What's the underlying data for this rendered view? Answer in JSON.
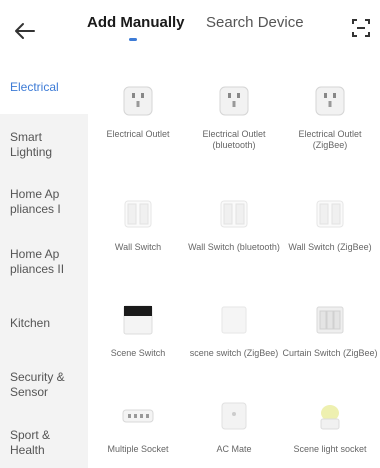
{
  "header": {
    "tabs": [
      {
        "label": "Add Manually",
        "active": true
      },
      {
        "label": "Search Device",
        "active": false
      }
    ],
    "icons": [
      "back-arrow-icon",
      "scan-icon"
    ]
  },
  "sidebar": {
    "items": [
      {
        "label": "Electrical",
        "active": true
      },
      {
        "label": "Smart Lighting"
      },
      {
        "label": "Home Ap pliances I"
      },
      {
        "label": "Home Ap pliances II"
      },
      {
        "label": "Kitchen"
      },
      {
        "label": "Security & Sensor"
      },
      {
        "label": "Sport & Health"
      }
    ]
  },
  "devices": [
    {
      "label": "Electrical Outlet",
      "icon": "outlet-icon"
    },
    {
      "label": "Electrical Outlet (bluetooth)",
      "icon": "outlet-icon"
    },
    {
      "label": "Electrical Outlet (ZigBee)",
      "icon": "outlet-icon"
    },
    {
      "label": "Wall Switch",
      "icon": "wall-switch-icon"
    },
    {
      "label": "Wall Switch (bluetooth)",
      "icon": "wall-switch-icon"
    },
    {
      "label": "Wall Switch (ZigBee)",
      "icon": "wall-switch-icon"
    },
    {
      "label": "Scene Switch",
      "icon": "scene-switch-icon"
    },
    {
      "label": "scene switch (ZigBee)",
      "icon": "scene-switch-icon"
    },
    {
      "label": "Curtain Switch (ZigBee)",
      "icon": "curtain-switch-icon"
    },
    {
      "label": "Multiple Socket",
      "icon": "power-strip-icon"
    },
    {
      "label": "AC Mate",
      "icon": "ac-mate-icon"
    },
    {
      "label": "Scene light socket",
      "icon": "light-socket-icon"
    }
  ],
  "colors": {
    "accent": "#3d7bd6",
    "sidebar_bg": "#f3f3f3",
    "text_muted": "#666666"
  }
}
